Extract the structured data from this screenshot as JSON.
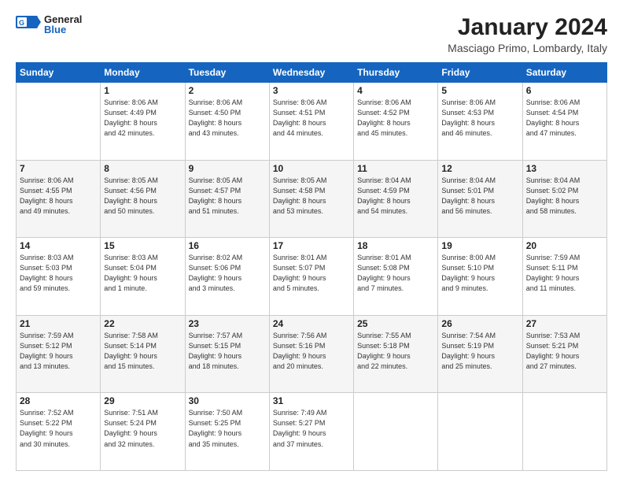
{
  "logo": {
    "general": "General",
    "blue": "Blue"
  },
  "header": {
    "title": "January 2024",
    "subtitle": "Masciago Primo, Lombardy, Italy"
  },
  "weekdays": [
    "Sunday",
    "Monday",
    "Tuesday",
    "Wednesday",
    "Thursday",
    "Friday",
    "Saturday"
  ],
  "weeks": [
    [
      {
        "day": "",
        "info": ""
      },
      {
        "day": "1",
        "info": "Sunrise: 8:06 AM\nSunset: 4:49 PM\nDaylight: 8 hours\nand 42 minutes."
      },
      {
        "day": "2",
        "info": "Sunrise: 8:06 AM\nSunset: 4:50 PM\nDaylight: 8 hours\nand 43 minutes."
      },
      {
        "day": "3",
        "info": "Sunrise: 8:06 AM\nSunset: 4:51 PM\nDaylight: 8 hours\nand 44 minutes."
      },
      {
        "day": "4",
        "info": "Sunrise: 8:06 AM\nSunset: 4:52 PM\nDaylight: 8 hours\nand 45 minutes."
      },
      {
        "day": "5",
        "info": "Sunrise: 8:06 AM\nSunset: 4:53 PM\nDaylight: 8 hours\nand 46 minutes."
      },
      {
        "day": "6",
        "info": "Sunrise: 8:06 AM\nSunset: 4:54 PM\nDaylight: 8 hours\nand 47 minutes."
      }
    ],
    [
      {
        "day": "7",
        "info": "Sunrise: 8:06 AM\nSunset: 4:55 PM\nDaylight: 8 hours\nand 49 minutes."
      },
      {
        "day": "8",
        "info": "Sunrise: 8:05 AM\nSunset: 4:56 PM\nDaylight: 8 hours\nand 50 minutes."
      },
      {
        "day": "9",
        "info": "Sunrise: 8:05 AM\nSunset: 4:57 PM\nDaylight: 8 hours\nand 51 minutes."
      },
      {
        "day": "10",
        "info": "Sunrise: 8:05 AM\nSunset: 4:58 PM\nDaylight: 8 hours\nand 53 minutes."
      },
      {
        "day": "11",
        "info": "Sunrise: 8:04 AM\nSunset: 4:59 PM\nDaylight: 8 hours\nand 54 minutes."
      },
      {
        "day": "12",
        "info": "Sunrise: 8:04 AM\nSunset: 5:01 PM\nDaylight: 8 hours\nand 56 minutes."
      },
      {
        "day": "13",
        "info": "Sunrise: 8:04 AM\nSunset: 5:02 PM\nDaylight: 8 hours\nand 58 minutes."
      }
    ],
    [
      {
        "day": "14",
        "info": "Sunrise: 8:03 AM\nSunset: 5:03 PM\nDaylight: 8 hours\nand 59 minutes."
      },
      {
        "day": "15",
        "info": "Sunrise: 8:03 AM\nSunset: 5:04 PM\nDaylight: 9 hours\nand 1 minute."
      },
      {
        "day": "16",
        "info": "Sunrise: 8:02 AM\nSunset: 5:06 PM\nDaylight: 9 hours\nand 3 minutes."
      },
      {
        "day": "17",
        "info": "Sunrise: 8:01 AM\nSunset: 5:07 PM\nDaylight: 9 hours\nand 5 minutes."
      },
      {
        "day": "18",
        "info": "Sunrise: 8:01 AM\nSunset: 5:08 PM\nDaylight: 9 hours\nand 7 minutes."
      },
      {
        "day": "19",
        "info": "Sunrise: 8:00 AM\nSunset: 5:10 PM\nDaylight: 9 hours\nand 9 minutes."
      },
      {
        "day": "20",
        "info": "Sunrise: 7:59 AM\nSunset: 5:11 PM\nDaylight: 9 hours\nand 11 minutes."
      }
    ],
    [
      {
        "day": "21",
        "info": "Sunrise: 7:59 AM\nSunset: 5:12 PM\nDaylight: 9 hours\nand 13 minutes."
      },
      {
        "day": "22",
        "info": "Sunrise: 7:58 AM\nSunset: 5:14 PM\nDaylight: 9 hours\nand 15 minutes."
      },
      {
        "day": "23",
        "info": "Sunrise: 7:57 AM\nSunset: 5:15 PM\nDaylight: 9 hours\nand 18 minutes."
      },
      {
        "day": "24",
        "info": "Sunrise: 7:56 AM\nSunset: 5:16 PM\nDaylight: 9 hours\nand 20 minutes."
      },
      {
        "day": "25",
        "info": "Sunrise: 7:55 AM\nSunset: 5:18 PM\nDaylight: 9 hours\nand 22 minutes."
      },
      {
        "day": "26",
        "info": "Sunrise: 7:54 AM\nSunset: 5:19 PM\nDaylight: 9 hours\nand 25 minutes."
      },
      {
        "day": "27",
        "info": "Sunrise: 7:53 AM\nSunset: 5:21 PM\nDaylight: 9 hours\nand 27 minutes."
      }
    ],
    [
      {
        "day": "28",
        "info": "Sunrise: 7:52 AM\nSunset: 5:22 PM\nDaylight: 9 hours\nand 30 minutes."
      },
      {
        "day": "29",
        "info": "Sunrise: 7:51 AM\nSunset: 5:24 PM\nDaylight: 9 hours\nand 32 minutes."
      },
      {
        "day": "30",
        "info": "Sunrise: 7:50 AM\nSunset: 5:25 PM\nDaylight: 9 hours\nand 35 minutes."
      },
      {
        "day": "31",
        "info": "Sunrise: 7:49 AM\nSunset: 5:27 PM\nDaylight: 9 hours\nand 37 minutes."
      },
      {
        "day": "",
        "info": ""
      },
      {
        "day": "",
        "info": ""
      },
      {
        "day": "",
        "info": ""
      }
    ]
  ]
}
